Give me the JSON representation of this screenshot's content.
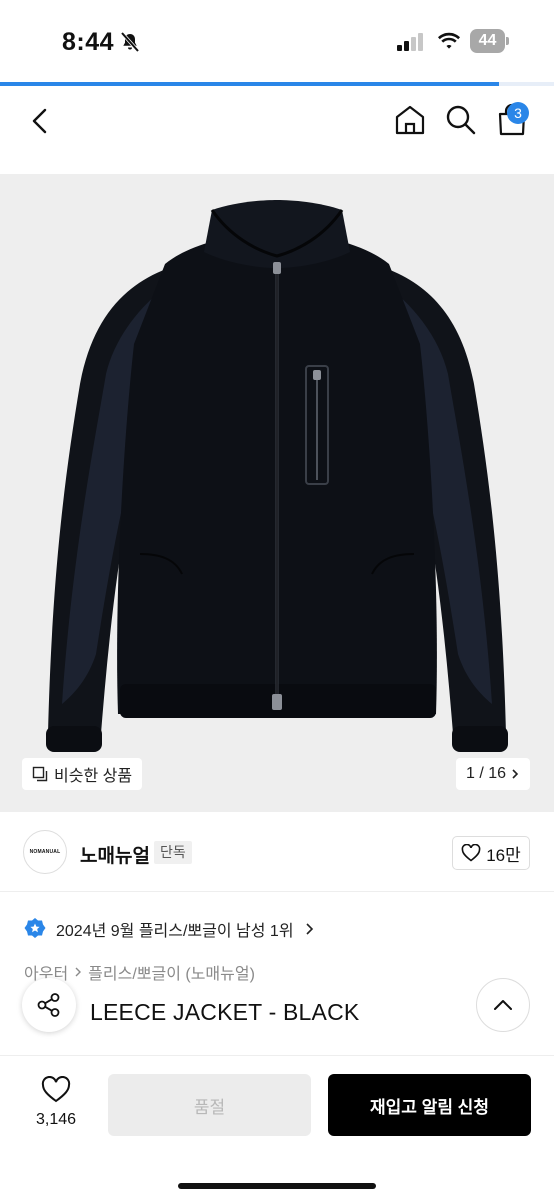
{
  "status_bar": {
    "time": "8:44",
    "battery": "44",
    "icons": [
      "bell-slash-icon",
      "cellular-signal-icon",
      "wifi-icon",
      "battery-icon"
    ]
  },
  "page_load": {
    "progress": 0.9,
    "color": "#2a86e8"
  },
  "nav": {
    "icons": [
      "back-chevron-icon",
      "home-icon",
      "search-icon",
      "shopping-bag-icon"
    ],
    "cart_count": "3"
  },
  "gallery": {
    "similar_label": "비슷한 상품",
    "counter": "1 / 16",
    "image_alt_icon": "black-fleece-jacket-photo"
  },
  "brand": {
    "logo_text": "NOMANUAL",
    "name": "노매뉴얼",
    "tag": "단독",
    "likes": "16만"
  },
  "ranking": {
    "text": "2024년 9월 플리스/뽀글이 남성 1위",
    "badge_color": "#2a86e8"
  },
  "breadcrumb": {
    "category": "아우터",
    "subcategory": "플리스/뽀글이 (노매뉴얼)"
  },
  "product": {
    "title": "LEECE JACKET - BLACK"
  },
  "bottom_bar": {
    "wish_count": "3,146",
    "soldout_label": "품절",
    "restock_label": "재입고 알림 신청"
  },
  "colors": {
    "accent": "#2a86e8",
    "primary_button": "#000000",
    "disabled_button": "#ececec"
  }
}
